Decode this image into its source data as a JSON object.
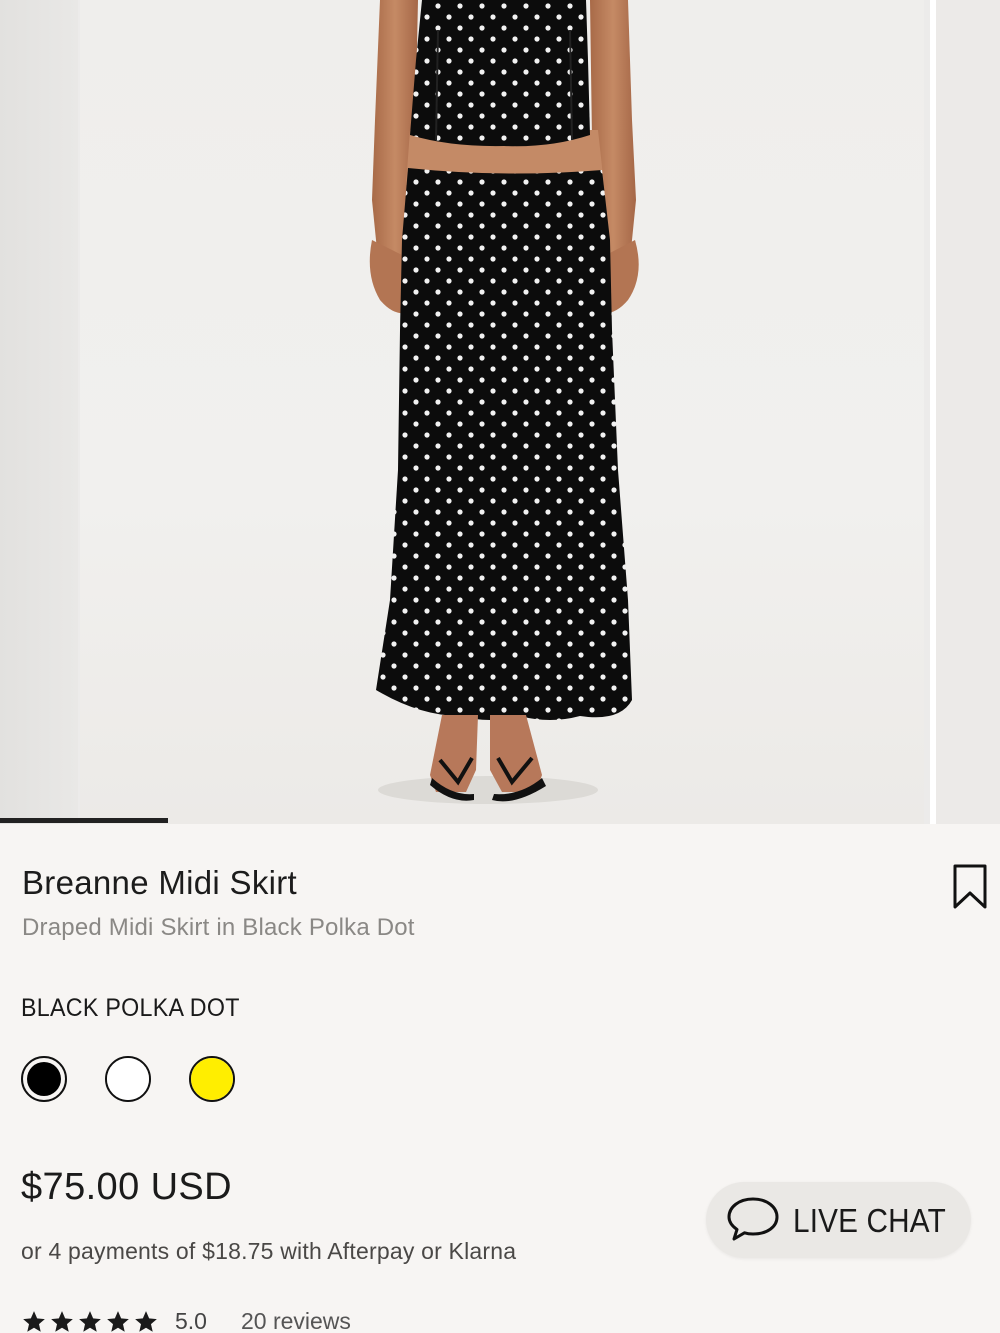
{
  "gallery": {
    "image_alt": "Model wearing black polka dot midi skirt and matching top",
    "progress": 0.168
  },
  "product": {
    "title": "Breanne Midi Skirt",
    "subtitle": "Draped Midi Skirt in Black Polka Dot",
    "color_name": "BLACK POLKA DOT",
    "swatches": [
      {
        "name": "Black Polka Dot",
        "color": "#000000",
        "selected": true
      },
      {
        "name": "White",
        "color": "#ffffff",
        "selected": false
      },
      {
        "name": "Yellow",
        "color": "#ffee00",
        "selected": false
      }
    ],
    "price": "$75.00 USD",
    "installments": "or 4 payments of $18.75 with Afterpay or Klarna",
    "rating": {
      "stars": 5,
      "value": "5.0",
      "reviews": "20 reviews"
    }
  },
  "icons": {
    "bookmark": "bookmark-icon",
    "chat": "chat-bubble-icon",
    "star": "star-icon"
  },
  "live_chat": {
    "label": "LIVE CHAT"
  }
}
